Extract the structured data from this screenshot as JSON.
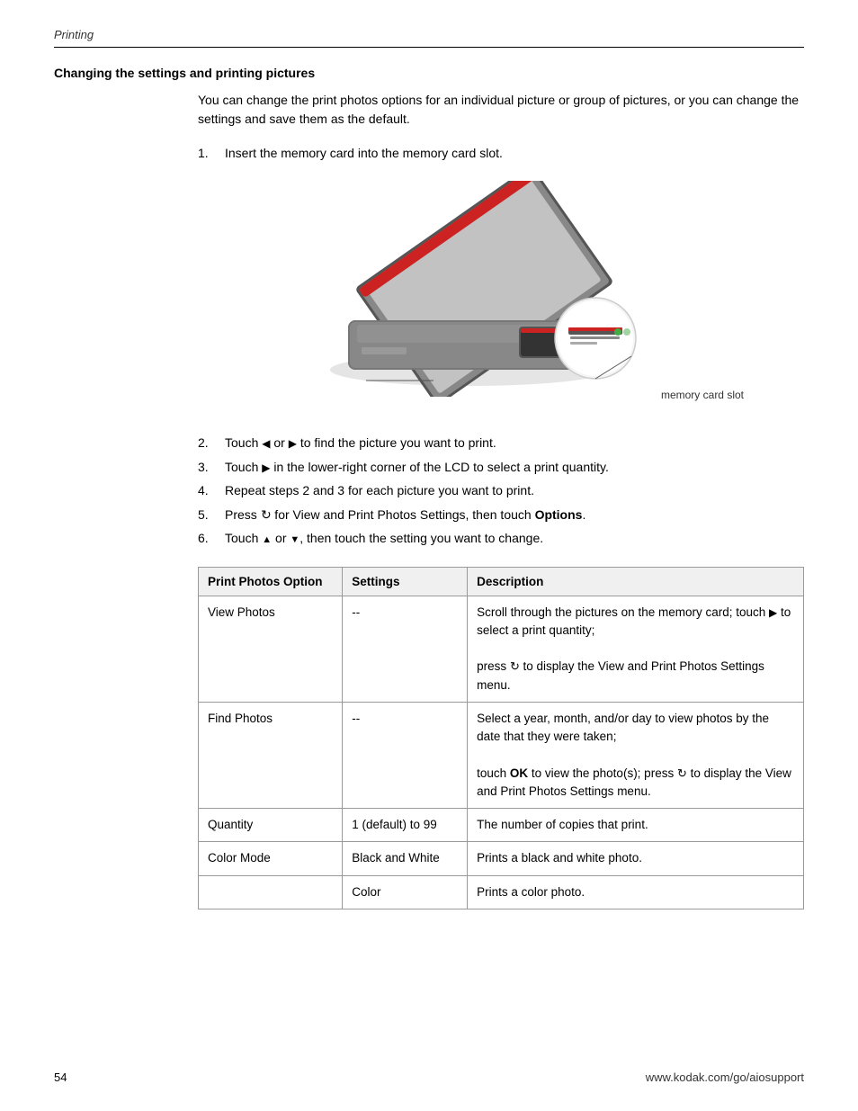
{
  "header": {
    "label": "Printing"
  },
  "section": {
    "title": "Changing the settings and printing pictures",
    "intro": "You can change the print photos options for an individual picture or group of pictures, or you can change the settings and save them as the default."
  },
  "steps": [
    {
      "num": "1.",
      "text": "Insert the memory card into the memory card slot."
    },
    {
      "num": "2.",
      "text_before": "Touch",
      "icon1": "◀",
      "text_mid": "or",
      "icon2": "▶",
      "text_after": "to find the picture you want to print."
    },
    {
      "num": "3.",
      "text_before": "Touch",
      "icon1": "▶",
      "text_after": "in the lower-right corner of the LCD to select a print quantity."
    },
    {
      "num": "4.",
      "text": "Repeat steps 2 and 3 for each picture you want to print."
    },
    {
      "num": "5.",
      "text_before": "Press",
      "icon1": "↺",
      "text_after": "for View and Print Photos Settings, then touch",
      "bold_word": "Options",
      "text_end": "."
    },
    {
      "num": "6.",
      "text_before": "Touch",
      "icon1": "▲",
      "text_mid": "or",
      "icon2": "▼",
      "text_after": ", then touch the setting you want to change."
    }
  ],
  "printer_label": "memory card slot",
  "table": {
    "headers": [
      "Print Photos Option",
      "Settings",
      "Description"
    ],
    "rows": [
      {
        "option": "View Photos",
        "settings": "--",
        "description": "Scroll through the pictures on the memory card; touch ▶ to select a print quantity; press ↺ to display the View and Print Photos Settings menu."
      },
      {
        "option": "Find Photos",
        "settings": "--",
        "description": "Select a year, month, and/or day to view photos by the date that they were taken; touch OK to view the photo(s); press ↺ to display the View and Print Photos Settings menu."
      },
      {
        "option": "Quantity",
        "settings": "1 (default) to 99",
        "description": "The number of copies that print."
      },
      {
        "option": "Color Mode",
        "settings": "Black and White",
        "description": "Prints a black and white photo."
      },
      {
        "option": "",
        "settings": "Color",
        "description": "Prints a color photo."
      }
    ]
  },
  "footer": {
    "page_number": "54",
    "url": "www.kodak.com/go/aiosupport"
  }
}
